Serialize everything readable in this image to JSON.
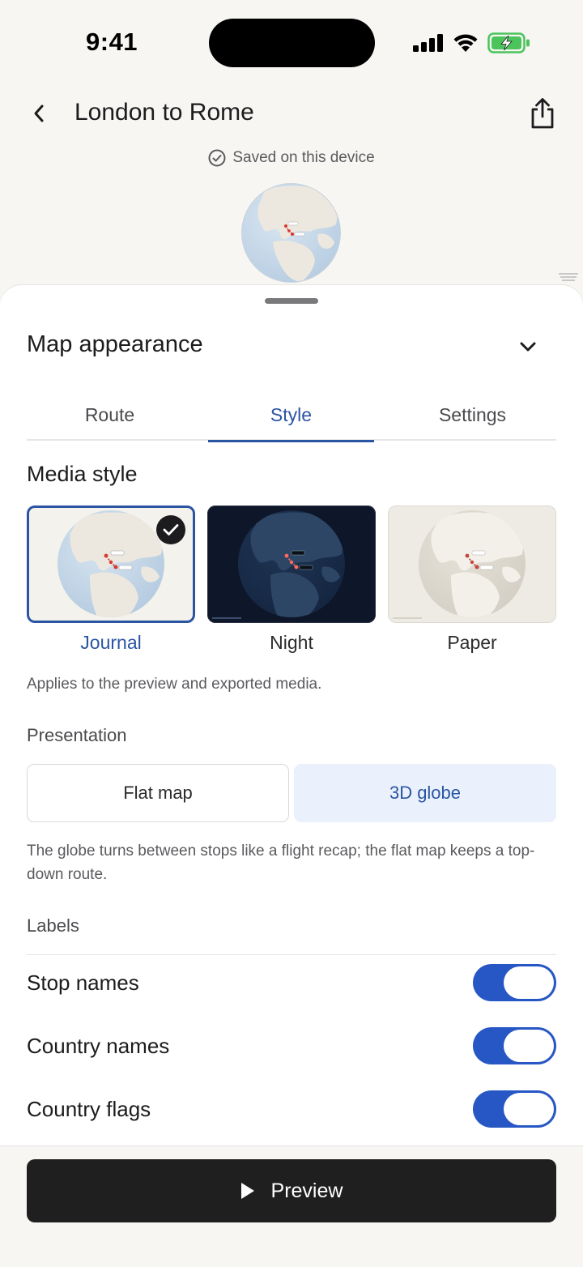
{
  "status_bar": {
    "time": "9:41"
  },
  "header": {
    "title": "London to Rome",
    "saved_text": "Saved on this device"
  },
  "sheet": {
    "title": "Map appearance",
    "tabs": [
      {
        "label": "Route",
        "active": false
      },
      {
        "label": "Style",
        "active": true
      },
      {
        "label": "Settings",
        "active": false
      }
    ],
    "media_style": {
      "title": "Media style",
      "options": [
        {
          "name": "Journal",
          "selected": true
        },
        {
          "name": "Night",
          "selected": false
        },
        {
          "name": "Paper",
          "selected": false
        }
      ],
      "helper": "Applies to the preview and exported media."
    },
    "presentation": {
      "label": "Presentation",
      "options": [
        {
          "label": "Flat map",
          "selected": false
        },
        {
          "label": "3D globe",
          "selected": true
        }
      ],
      "helper": "The globe turns between stops like a flight recap; the flat map keeps a top-down route."
    },
    "labels": {
      "label": "Labels",
      "toggles": [
        {
          "label": "Stop names",
          "on": true
        },
        {
          "label": "Country names",
          "on": true
        },
        {
          "label": "Country flags",
          "on": true
        }
      ]
    }
  },
  "footer": {
    "preview_label": "Preview"
  },
  "colors": {
    "accent": "#2b55a3",
    "toggle_on": "#2657c4",
    "primary_button": "#1f1f1f",
    "route": "#d9372b"
  },
  "icons": {
    "back": "chevron-left-icon",
    "share": "share-icon",
    "saved": "check-circle-icon",
    "collapse": "chevron-down-icon",
    "selected": "checkmark-icon",
    "preview": "play-icon"
  }
}
